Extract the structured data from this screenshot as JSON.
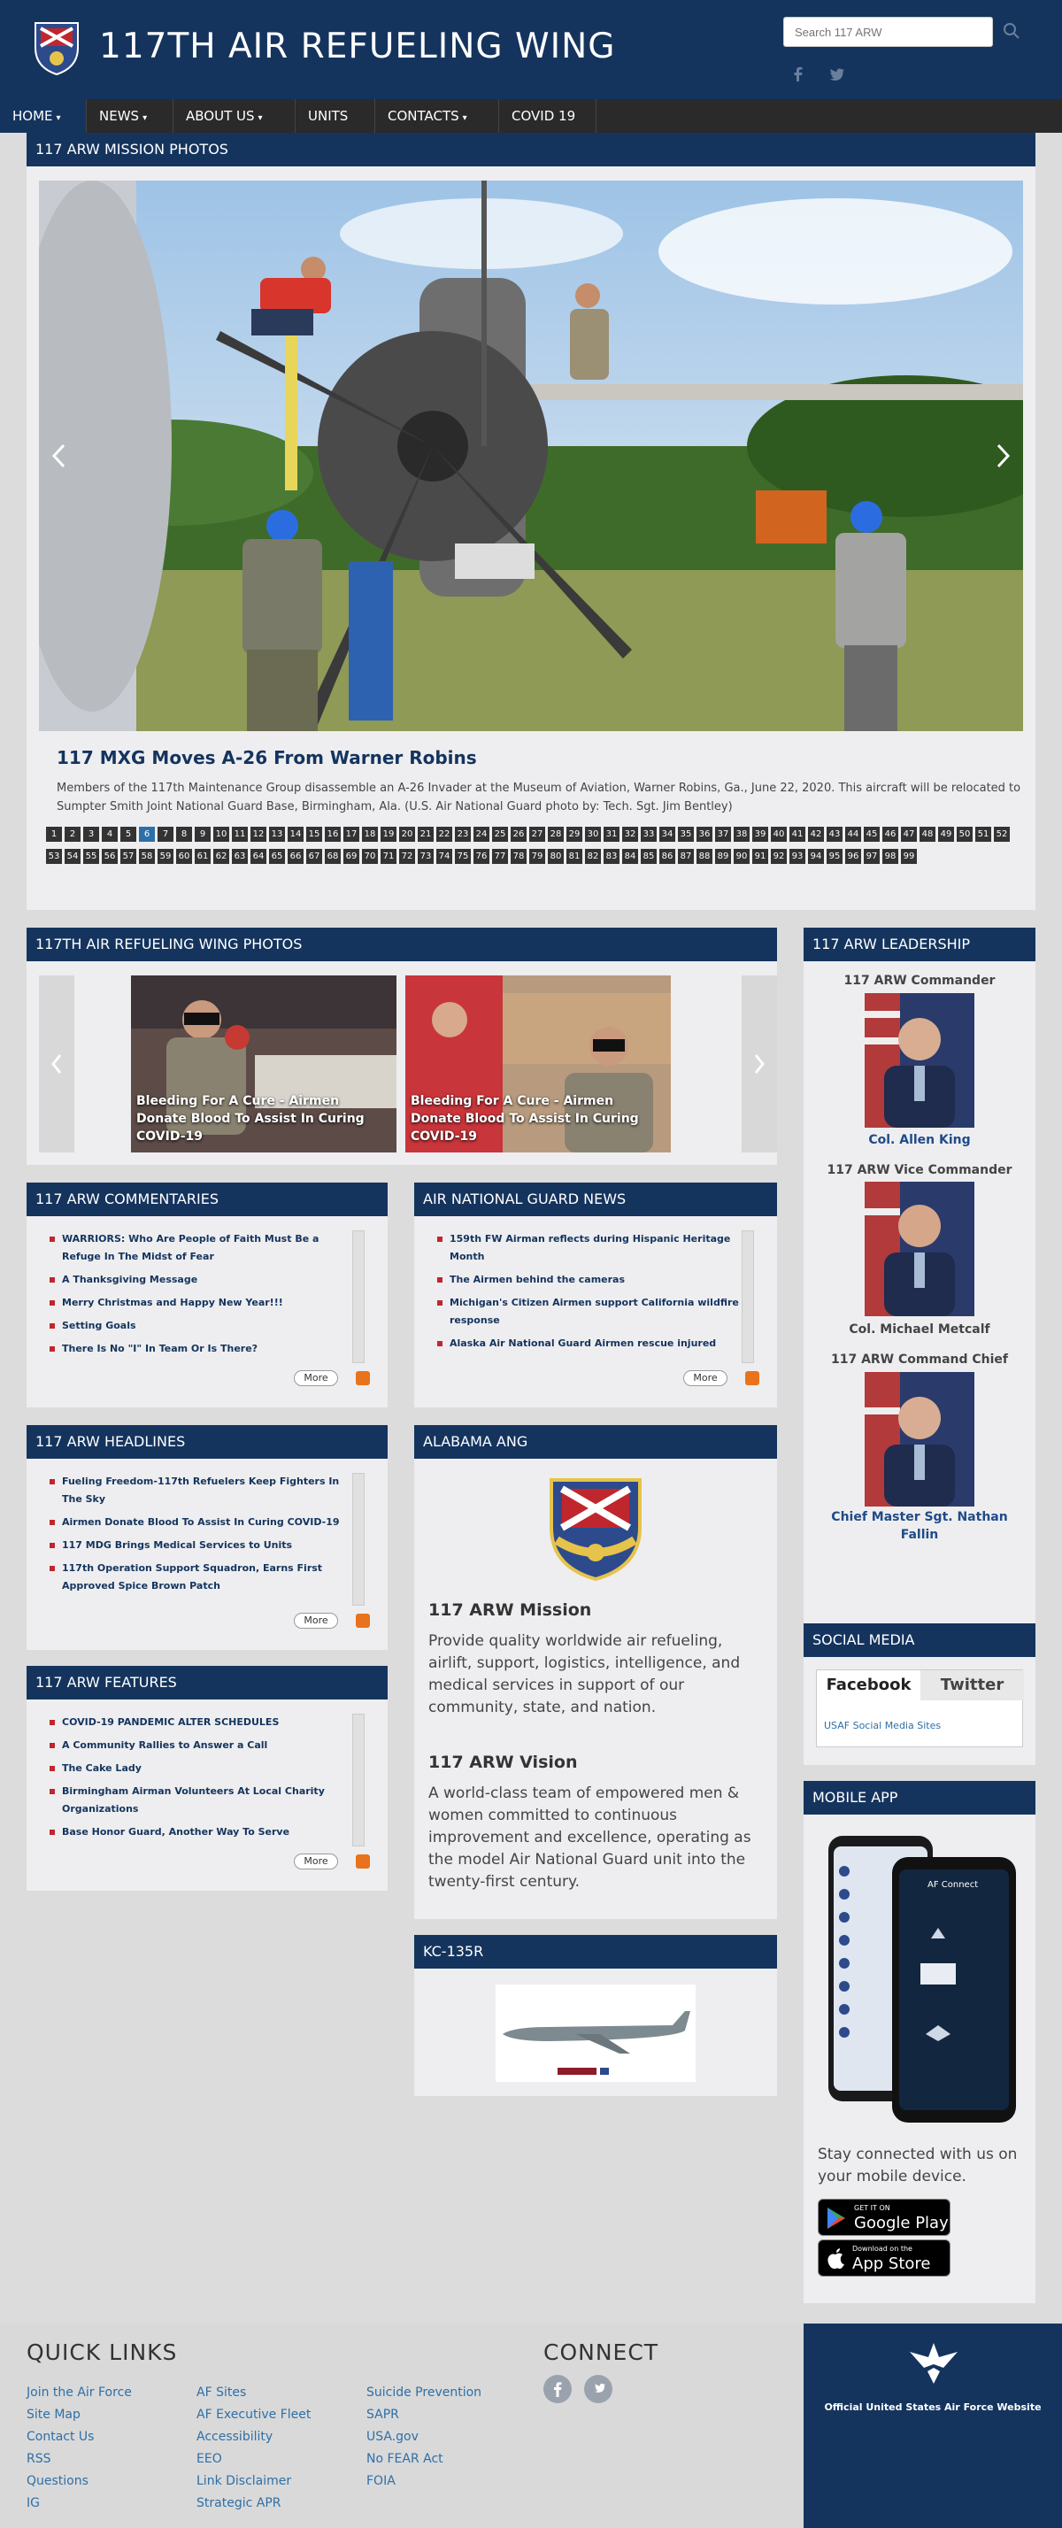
{
  "header": {
    "site_title": "117TH AIR REFUELING WING",
    "search_placeholder": "Search 117 ARW",
    "emblem_icon": "wing-emblem-icon",
    "search_icon": "search-icon",
    "social_icons": [
      "facebook-icon",
      "twitter-icon"
    ]
  },
  "nav": {
    "items": [
      {
        "label": "HOME",
        "caret": true
      },
      {
        "label": "NEWS",
        "caret": true
      },
      {
        "label": "ABOUT US",
        "caret": true
      },
      {
        "label": "UNITS",
        "caret": false
      },
      {
        "label": "CONTACTS",
        "caret": true
      },
      {
        "label": "COVID 19",
        "caret": false
      }
    ]
  },
  "mission": {
    "heading": "117 ARW MISSION PHOTOS",
    "title": "117 MXG Moves A-26 From Warner Robins",
    "description": "Members of the 117th Maintenance Group disassemble an A-26 Invader at the Museum of Aviation, Warner Robins, Ga., June 22, 2020. This aircraft will be relocated to Sumpter Smith Joint National Guard Base, Birmingham, Ala. (U.S. Air National Guard photo by: Tech. Sgt. Jim Bentley)",
    "pages": [
      "1",
      "2",
      "3",
      "4",
      "5",
      "6",
      "7",
      "8",
      "9",
      "10",
      "11",
      "12",
      "13",
      "14",
      "15",
      "16",
      "17",
      "18",
      "19",
      "20",
      "21",
      "22",
      "23",
      "24",
      "25",
      "26",
      "27",
      "28",
      "29",
      "30",
      "31",
      "32",
      "33",
      "34",
      "35",
      "36",
      "37",
      "38",
      "39",
      "40",
      "41",
      "42",
      "43",
      "44",
      "45",
      "46",
      "47",
      "48",
      "49",
      "50",
      "51",
      "52",
      "53",
      "54",
      "55",
      "56",
      "57",
      "58",
      "59",
      "60",
      "61",
      "62",
      "63",
      "64",
      "65",
      "66",
      "67",
      "68",
      "69",
      "70",
      "71",
      "72",
      "73",
      "74",
      "75",
      "76",
      "77",
      "78",
      "79",
      "80",
      "81",
      "82",
      "83",
      "84",
      "85",
      "86",
      "87",
      "88",
      "89",
      "90",
      "91",
      "92",
      "93",
      "94",
      "95",
      "96",
      "97",
      "98",
      "99"
    ],
    "active_page": "6"
  },
  "wing_photos": {
    "heading": "117TH AIR REFUELING WING PHOTOS",
    "captions": [
      "Bleeding For A Cure - Airmen Donate Blood To Assist In Curing COVID-19",
      "Bleeding For A Cure - Airmen Donate Blood To Assist In Curing COVID-19"
    ]
  },
  "leadership": {
    "heading": "117 ARW LEADERSHIP",
    "people": [
      {
        "role": "117 ARW Commander",
        "name": "Col. Allen King"
      },
      {
        "role": "117 ARW Vice Commander",
        "name": "Col. Michael Metcalf"
      },
      {
        "role": "117 ARW Command Chief",
        "name": "Chief Master Sgt. Nathan Fallin"
      }
    ]
  },
  "commentaries": {
    "heading": "117 ARW COMMENTARIES",
    "items": [
      "WARRIORS: Who Are People of Faith Must Be a Refuge In The Midst of Fear",
      "A Thanksgiving Message",
      "Merry Christmas and Happy New Year!!!",
      "Setting Goals",
      "There Is No \"I\" In Team Or Is There?"
    ],
    "more": "More"
  },
  "ang_news": {
    "heading": "AIR NATIONAL GUARD NEWS",
    "items": [
      "159th FW Airman reflects during Hispanic Heritage Month",
      "The Airmen behind the cameras",
      "Michigan's Citizen Airmen support California wildfire response",
      "Alaska Air National Guard Airmen rescue injured"
    ],
    "more": "More"
  },
  "headlines": {
    "heading": "117 ARW HEADLINES",
    "items": [
      "Fueling Freedom-117th Refuelers Keep Fighters In The Sky",
      "Airmen Donate Blood To Assist In Curing COVID-19",
      "117 MDG Brings Medical Services to Units",
      "117th Operation Support Squadron, Earns First Approved Spice Brown Patch"
    ],
    "more": "More"
  },
  "features": {
    "heading": "117 ARW FEATURES",
    "items": [
      "COVID-19 PANDEMIC ALTER SCHEDULES",
      "A Community Rallies to Answer a Call",
      "The Cake Lady",
      "Birmingham Airman Volunteers At Local Charity Organizations",
      "Base Honor Guard, Another Way To Serve"
    ],
    "more": "More"
  },
  "alabama": {
    "heading": "ALABAMA ANG",
    "mission_title": "117 ARW Mission",
    "mission_text": "Provide quality worldwide air refueling, airlift, support, logistics, intelligence, and medical services in support of our community, state, and nation.",
    "vision_title": "117 ARW Vision",
    "vision_text": "A world-class team of empowered men & women committed to continuous improvement and excellence, operating as the model Air National Guard unit into the twenty-first century."
  },
  "kc135": {
    "heading": "KC-135R"
  },
  "social": {
    "heading": "SOCIAL MEDIA",
    "tabs": [
      "Facebook",
      "Twitter"
    ],
    "link": "USAF Social Media Sites"
  },
  "app": {
    "heading": "MOBILE APP",
    "text": "Stay connected with us on your mobile device.",
    "google_small": "GET IT ON",
    "google_big": "Google Play",
    "apple_small": "Download on the",
    "apple_big": "App Store",
    "phone_title": "AF Connect"
  },
  "footer": {
    "quick_title": "QUICK LINKS",
    "col1": [
      "Join the Air Force",
      "Site Map",
      "Contact Us",
      "RSS",
      "Questions",
      "IG"
    ],
    "col2": [
      "AF Sites",
      "AF Executive Fleet",
      "Accessibility",
      "EEO",
      "Link Disclaimer",
      "Strategic APR"
    ],
    "col3": [
      "Suicide Prevention",
      "SAPR",
      "USA.gov",
      "No FEAR Act",
      "FOIA"
    ],
    "connect_title": "CONNECT",
    "af_text": "Official United States Air Force Website"
  },
  "colors": {
    "navy": "#14345e",
    "nav_bg": "#2a2a2a",
    "link": "#2e6fa7",
    "bullet": "#c0262d"
  }
}
